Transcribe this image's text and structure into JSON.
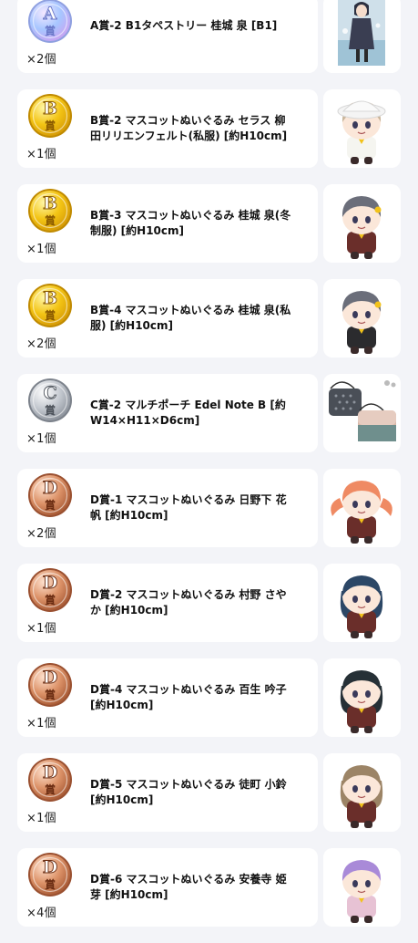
{
  "items": [
    {
      "medal_letter": "A",
      "medal_kanji": "賞",
      "medal_tier": "A",
      "title": "A賞-2 B1タペストリー 桂城 泉 [B1]",
      "qty": "×2個",
      "image": "tapestry"
    },
    {
      "medal_letter": "B",
      "medal_kanji": "賞",
      "medal_tier": "B",
      "title": "B賞-2 マスコットぬいぐるみ セラス 柳田リリエンフェルト(私服) [約H10cm]",
      "qty": "×1個",
      "image": "plush-white-hat"
    },
    {
      "medal_letter": "B",
      "medal_kanji": "賞",
      "medal_tier": "B",
      "title": "B賞-3 マスコットぬいぐるみ 桂城 泉(冬制服) [約H10cm]",
      "qty": "×1個",
      "image": "plush-grey-winter"
    },
    {
      "medal_letter": "B",
      "medal_kanji": "賞",
      "medal_tier": "B",
      "title": "B賞-4 マスコットぬいぐるみ 桂城 泉(私服) [約H10cm]",
      "qty": "×2個",
      "image": "plush-grey-casual"
    },
    {
      "medal_letter": "C",
      "medal_kanji": "賞",
      "medal_tier": "C",
      "title": "C賞-2 マルチポーチ Edel Note B [約W14×H11×D6cm]",
      "qty": "×1個",
      "image": "pouch"
    },
    {
      "medal_letter": "D",
      "medal_kanji": "賞",
      "medal_tier": "D",
      "title": "D賞-1 マスコットぬいぐるみ 日野下 花帆 [約H10cm]",
      "qty": "×2個",
      "image": "plush-orange"
    },
    {
      "medal_letter": "D",
      "medal_kanji": "賞",
      "medal_tier": "D",
      "title": "D賞-2 マスコットぬいぐるみ 村野 さやか [約H10cm]",
      "qty": "×1個",
      "image": "plush-navy"
    },
    {
      "medal_letter": "D",
      "medal_kanji": "賞",
      "medal_tier": "D",
      "title": "D賞-4 マスコットぬいぐるみ 百生 吟子 [約H10cm]",
      "qty": "×1個",
      "image": "plush-black"
    },
    {
      "medal_letter": "D",
      "medal_kanji": "賞",
      "medal_tier": "D",
      "title": "D賞-5 マスコットぬいぐるみ 徒町 小鈴 [約H10cm]",
      "qty": "×1個",
      "image": "plush-brown"
    },
    {
      "medal_letter": "D",
      "medal_kanji": "賞",
      "medal_tier": "D",
      "title": "D賞-6 マスコットぬいぐるみ 安養寺 姫芽 [約H10cm]",
      "qty": "×4個",
      "image": "plush-purple"
    }
  ],
  "colors": {
    "page_bg": "#f3f4f8",
    "card_bg": "#ffffff",
    "medal_A": "#b8a6f0",
    "medal_B": "#f2c21a",
    "medal_C": "#b9bfc8",
    "medal_D": "#d98d62"
  }
}
